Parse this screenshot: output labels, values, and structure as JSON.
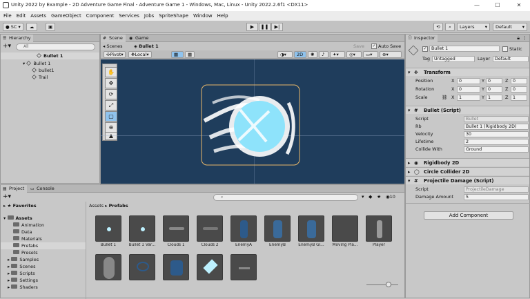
{
  "window": {
    "title": "Unity 2022 by Example - 2D Adventure Game Final - Adventure Game 1 - Windows, Mac, Linux - Unity 2022.2.6f1 <DX11>",
    "minimize": "—",
    "maximize": "☐",
    "close": "✕"
  },
  "menu": [
    "File",
    "Edit",
    "Assets",
    "GameObject",
    "Component",
    "Services",
    "Jobs",
    "SpriteShape",
    "Window",
    "Help"
  ],
  "toolbar": {
    "account": "SC",
    "layers": "Layers",
    "layout": "Default"
  },
  "hierarchy": {
    "tab": "Hierarchy",
    "search_placeholder": "All",
    "scene_root": "Bullet 1",
    "items": [
      {
        "label": "Bullet 1",
        "depth": 0
      },
      {
        "label": "bullet1",
        "depth": 1
      },
      {
        "label": "Trail",
        "depth": 1
      }
    ]
  },
  "scene": {
    "tabs": [
      "Scene",
      "Game"
    ],
    "breadcrumb_root": "Scenes",
    "breadcrumb_item": "Bullet 1",
    "save": "Save",
    "auto_save": "Auto Save",
    "pivot": "Pivot",
    "local": "Local",
    "colors": {
      "background": "#1f3d5c",
      "selection": "#e8b86a"
    }
  },
  "inspector": {
    "tab": "Inspector",
    "object_name": "Bullet 1",
    "static": "Static",
    "tag_label": "Tag",
    "tag": "Untagged",
    "layer_label": "Layer",
    "layer": "Default",
    "transform": {
      "title": "Transform",
      "rows": [
        {
          "label": "Position",
          "x": "0",
          "y": "0",
          "z": "0"
        },
        {
          "label": "Rotation",
          "x": "0",
          "y": "0",
          "z": "0"
        },
        {
          "label": "Scale",
          "x": "1",
          "y": "1",
          "z": "1"
        }
      ]
    },
    "bullet_script": {
      "title": "Bullet (Script)",
      "fields": [
        {
          "label": "Script",
          "value": "Bullet",
          "dim": true
        },
        {
          "label": "Rb",
          "value": "Bullet 1 (Rigidbody 2D)",
          "dim": false
        },
        {
          "label": "Velocity",
          "value": "30",
          "dim": false
        },
        {
          "label": "Lifetime",
          "value": "2",
          "dim": false
        },
        {
          "label": "Collide With",
          "value": "Ground",
          "dim": false
        }
      ]
    },
    "rigidbody": "Rigidbody 2D",
    "circle_collider": "Circle Collider 2D",
    "projectile": {
      "title": "Projectile Damage (Script)",
      "script_label": "Script",
      "script_value": "ProjectileDamage",
      "damage_label": "Damage Amount",
      "damage_value": "5"
    },
    "add_component": "Add Component"
  },
  "project": {
    "tabs": [
      "Project",
      "Console"
    ],
    "tree": [
      {
        "label": "Favorites",
        "depth": 0,
        "bold": true
      },
      {
        "label": "Assets",
        "depth": 0,
        "bold": true
      },
      {
        "label": "Animation",
        "depth": 1
      },
      {
        "label": "Data",
        "depth": 1
      },
      {
        "label": "Materials",
        "depth": 1
      },
      {
        "label": "Prefabs",
        "depth": 1,
        "selected": true
      },
      {
        "label": "Presets",
        "depth": 1
      },
      {
        "label": "Samples",
        "depth": 1
      },
      {
        "label": "Scenes",
        "depth": 1
      },
      {
        "label": "Scripts",
        "depth": 1
      },
      {
        "label": "Settings",
        "depth": 1
      },
      {
        "label": "Shaders",
        "depth": 1
      }
    ],
    "breadcrumb": [
      "Assets",
      "Prefabs"
    ],
    "count_badge": "10",
    "assets_row1": [
      "Bullet 1",
      "Bullet 1 Var...",
      "Clouds 1",
      "Clouds 2",
      "EnemyA",
      "EnemyB",
      "EnemyB Gl...",
      "Moving Pla...",
      "Player"
    ],
    "assets_row2": [
      "",
      "",
      "",
      "",
      ""
    ]
  }
}
